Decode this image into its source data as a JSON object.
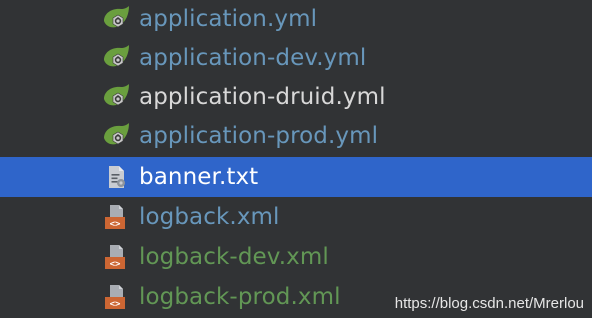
{
  "colors": {
    "background": "#313335",
    "selection": "#2f65ca",
    "blue_file": "#6897bb",
    "default_file": "#d8d8d8",
    "selected_file": "#ffffff",
    "green_file": "#629755",
    "spring_icon": "#6a9f3e",
    "xml_icon": "#cc6633"
  },
  "files": [
    {
      "name": "application.yml",
      "icon": "spring-config-icon",
      "color": "#6897bb",
      "selected": false
    },
    {
      "name": "application-dev.yml",
      "icon": "spring-config-icon",
      "color": "#6897bb",
      "selected": false
    },
    {
      "name": "application-druid.yml",
      "icon": "spring-config-icon",
      "color": "#d8d8d8",
      "selected": false
    },
    {
      "name": "application-prod.yml",
      "icon": "spring-config-icon",
      "color": "#6897bb",
      "selected": false
    },
    {
      "name": "banner.txt",
      "icon": "text-file-icon",
      "color": "#ffffff",
      "selected": true
    },
    {
      "name": "logback.xml",
      "icon": "xml-file-icon",
      "color": "#6897bb",
      "selected": false
    },
    {
      "name": "logback-dev.xml",
      "icon": "xml-file-icon",
      "color": "#629755",
      "selected": false
    },
    {
      "name": "logback-prod.xml",
      "icon": "xml-file-icon",
      "color": "#629755",
      "selected": false
    }
  ],
  "watermark": "https://blog.csdn.net/Mrerlou"
}
